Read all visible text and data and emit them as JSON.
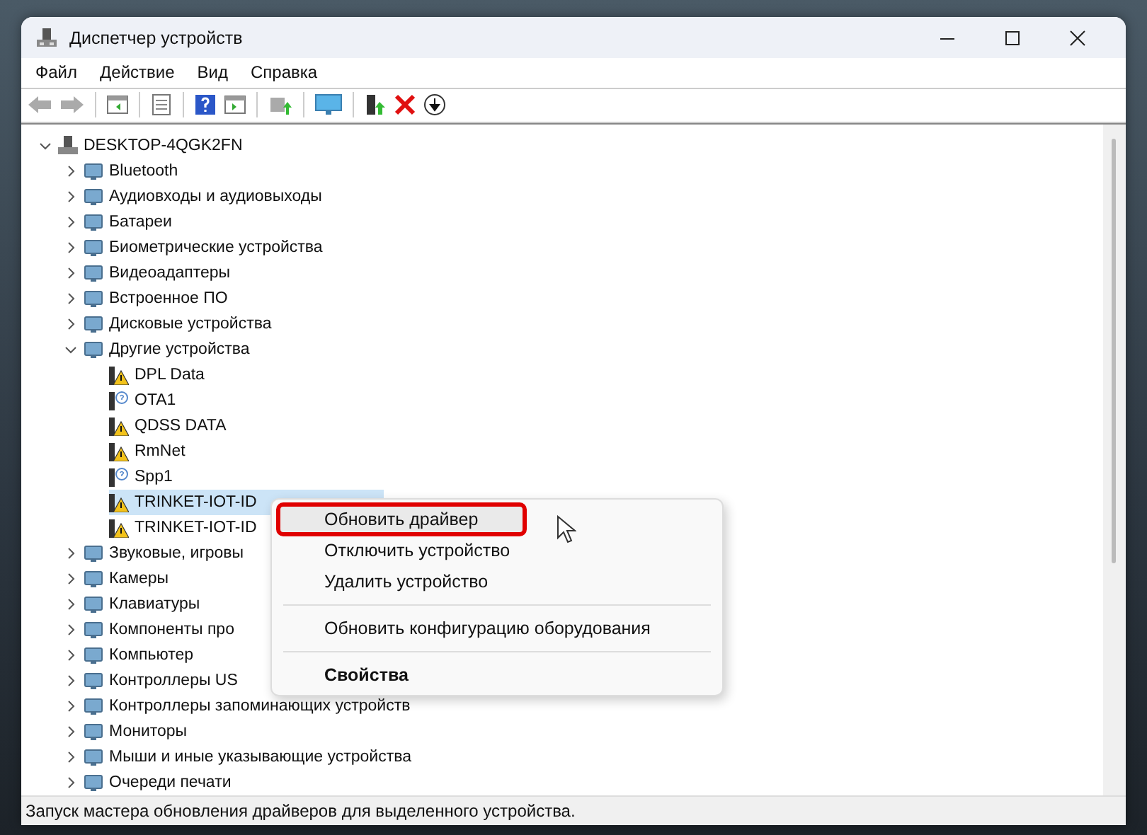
{
  "window": {
    "title": "Диспетчер устройств"
  },
  "menu": [
    "Файл",
    "Действие",
    "Вид",
    "Справка"
  ],
  "tree": {
    "label": "DESKTOP-4QGK2FN",
    "expanded": true,
    "selected": false,
    "children": [
      {
        "label": "Bluetooth",
        "expanded": false,
        "selected": false
      },
      {
        "label": "Аудиовходы и аудиовыходы",
        "expanded": false,
        "selected": false
      },
      {
        "label": "Батареи",
        "expanded": false,
        "selected": false
      },
      {
        "label": "Биометрические устройства",
        "expanded": false,
        "selected": false
      },
      {
        "label": "Видеоадаптеры",
        "expanded": false,
        "selected": false
      },
      {
        "label": "Встроенное ПО",
        "expanded": false,
        "selected": false
      },
      {
        "label": "Дисковые устройства",
        "expanded": false,
        "selected": false
      },
      {
        "label": "Другие устройства",
        "expanded": true,
        "selected": false,
        "children": [
          {
            "label": "DPL Data",
            "warning": true,
            "selected": false
          },
          {
            "label": "OTA1",
            "warning": false,
            "selected": false
          },
          {
            "label": "QDSS DATA",
            "warning": true,
            "selected": false
          },
          {
            "label": "RmNet",
            "warning": true,
            "selected": false
          },
          {
            "label": "Spp1",
            "warning": false,
            "selected": false
          },
          {
            "label": "TRINKET-IOT-ID",
            "warning": true,
            "selected": true
          },
          {
            "label": "TRINKET-IOT-ID",
            "warning": true,
            "selected": false
          }
        ]
      },
      {
        "label": "Звуковые, игровы",
        "expanded": false,
        "selected": false
      },
      {
        "label": "Камеры",
        "expanded": false,
        "selected": false
      },
      {
        "label": "Клавиатуры",
        "expanded": false,
        "selected": false
      },
      {
        "label": "Компоненты про",
        "expanded": false,
        "selected": false
      },
      {
        "label": "Компьютер",
        "expanded": false,
        "selected": false
      },
      {
        "label": "Контроллеры US",
        "expanded": false,
        "selected": false
      },
      {
        "label": "Контроллеры запоминающих устройств",
        "expanded": false,
        "selected": false
      },
      {
        "label": "Мониторы",
        "expanded": false,
        "selected": false
      },
      {
        "label": "Мыши и иные указывающие устройства",
        "expanded": false,
        "selected": false
      },
      {
        "label": "Очереди печати",
        "expanded": false,
        "selected": false
      }
    ]
  },
  "context_menu": [
    {
      "label": "Обновить драйвер",
      "hovered": true,
      "highlighted": true,
      "separator_before": false,
      "default": false
    },
    {
      "label": "Отключить устройство",
      "hovered": false,
      "highlighted": false,
      "separator_before": false,
      "default": false
    },
    {
      "label": "Удалить устройство",
      "hovered": false,
      "highlighted": false,
      "separator_before": false,
      "default": false
    },
    {
      "label": "Обновить конфигурацию оборудования",
      "hovered": false,
      "highlighted": false,
      "separator_before": true,
      "default": false
    },
    {
      "label": "Свойства",
      "hovered": false,
      "highlighted": false,
      "separator_before": true,
      "default": true
    }
  ],
  "status_bar": "Запуск мастера обновления драйверов для выделенного устройства."
}
